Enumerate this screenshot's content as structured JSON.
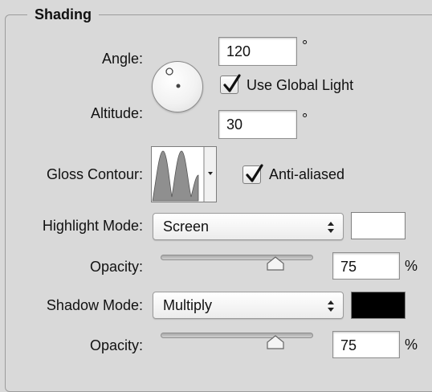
{
  "shading": {
    "title": "Shading",
    "angle": {
      "label": "Angle:",
      "value": "120",
      "unit": "°"
    },
    "use_global_light": {
      "label": "Use Global Light",
      "checked": true
    },
    "altitude": {
      "label": "Altitude:",
      "value": "30",
      "unit": "°"
    },
    "gloss_contour": {
      "label": "Gloss Contour:"
    },
    "anti_aliased": {
      "label": "Anti-aliased",
      "checked": true
    },
    "highlight_mode": {
      "label": "Highlight Mode:",
      "value": "Screen",
      "color": "#ffffff"
    },
    "highlight_opacity": {
      "label": "Opacity:",
      "value": "75",
      "unit": "%",
      "level_percent": 75
    },
    "shadow_mode": {
      "label": "Shadow Mode:",
      "value": "Multiply",
      "color": "#000000"
    },
    "shadow_opacity": {
      "label": "Opacity:",
      "value": "75",
      "unit": "%",
      "level_percent": 75
    }
  }
}
